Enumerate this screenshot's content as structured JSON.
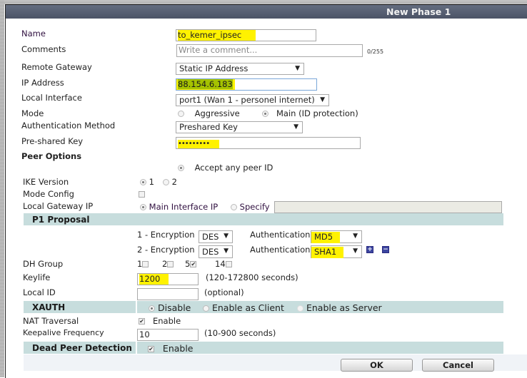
{
  "dialog": {
    "title": "New Phase 1"
  },
  "fields": {
    "name": {
      "label": "Name",
      "value": "to_kemer_ipsec"
    },
    "comments": {
      "label": "Comments",
      "placeholder": "Write a comment...",
      "counter": "0/255"
    },
    "remote_gateway": {
      "label": "Remote Gateway",
      "selected": "Static IP Address"
    },
    "ip_address": {
      "label": "IP Address",
      "value": "88.154.6.183"
    },
    "local_interface": {
      "label": "Local Interface",
      "selected": "port1 (Wan 1 - personel internet)"
    },
    "mode": {
      "label": "Mode",
      "options": [
        "Aggressive",
        "Main (ID protection)"
      ],
      "selected": "Main (ID protection)"
    },
    "auth_method": {
      "label": "Authentication Method",
      "selected": "Preshared Key"
    },
    "psk": {
      "label": "Pre-shared Key",
      "value": "•••••••••"
    }
  },
  "peer_options": {
    "heading": "Peer Options",
    "accept_label": "Accept any peer ID",
    "ike_version": {
      "label": "IKE Version",
      "options": [
        "1",
        "2"
      ],
      "selected": "1"
    },
    "mode_config": {
      "label": "Mode Config",
      "checked": false
    },
    "local_gateway": {
      "label": "Local Gateway IP",
      "options": [
        "Main Interface IP",
        "Specify"
      ],
      "selected": "Main Interface IP",
      "specify_value": ""
    }
  },
  "p1_proposal": {
    "heading": "P1 Proposal",
    "rows": [
      {
        "enc_label": "1 - Encryption",
        "enc": "DES",
        "auth_label": "Authentication",
        "auth": "MD5"
      },
      {
        "enc_label": "2 - Encryption",
        "enc": "DES",
        "auth_label": "Authentication",
        "auth": "SHA1"
      }
    ],
    "add_icon": "+",
    "remove_icon": "−",
    "dh_group": {
      "label": "DH Group",
      "options": [
        {
          "value": "1",
          "checked": false
        },
        {
          "value": "2",
          "checked": false
        },
        {
          "value": "5",
          "checked": true
        },
        {
          "value": "14",
          "checked": false
        }
      ]
    },
    "keylife": {
      "label": "Keylife",
      "value": "1200",
      "hint": "(120-172800 seconds)"
    },
    "local_id": {
      "label": "Local ID",
      "value": "",
      "hint": "(optional)"
    }
  },
  "xauth": {
    "heading": "XAUTH",
    "options": [
      "Disable",
      "Enable as Client",
      "Enable as Server"
    ],
    "selected": "Disable"
  },
  "nat": {
    "label": "NAT Traversal",
    "option": "Enable",
    "checked": true
  },
  "keepalive": {
    "label": "Keepalive Frequency",
    "value": "10",
    "hint": "(10-900 seconds)"
  },
  "dpd": {
    "heading": "Dead Peer Detection",
    "option": "Enable",
    "checked": true
  },
  "buttons": {
    "ok": "OK",
    "cancel": "Cancel"
  },
  "check_mark": "✔",
  "arrow": "▼"
}
